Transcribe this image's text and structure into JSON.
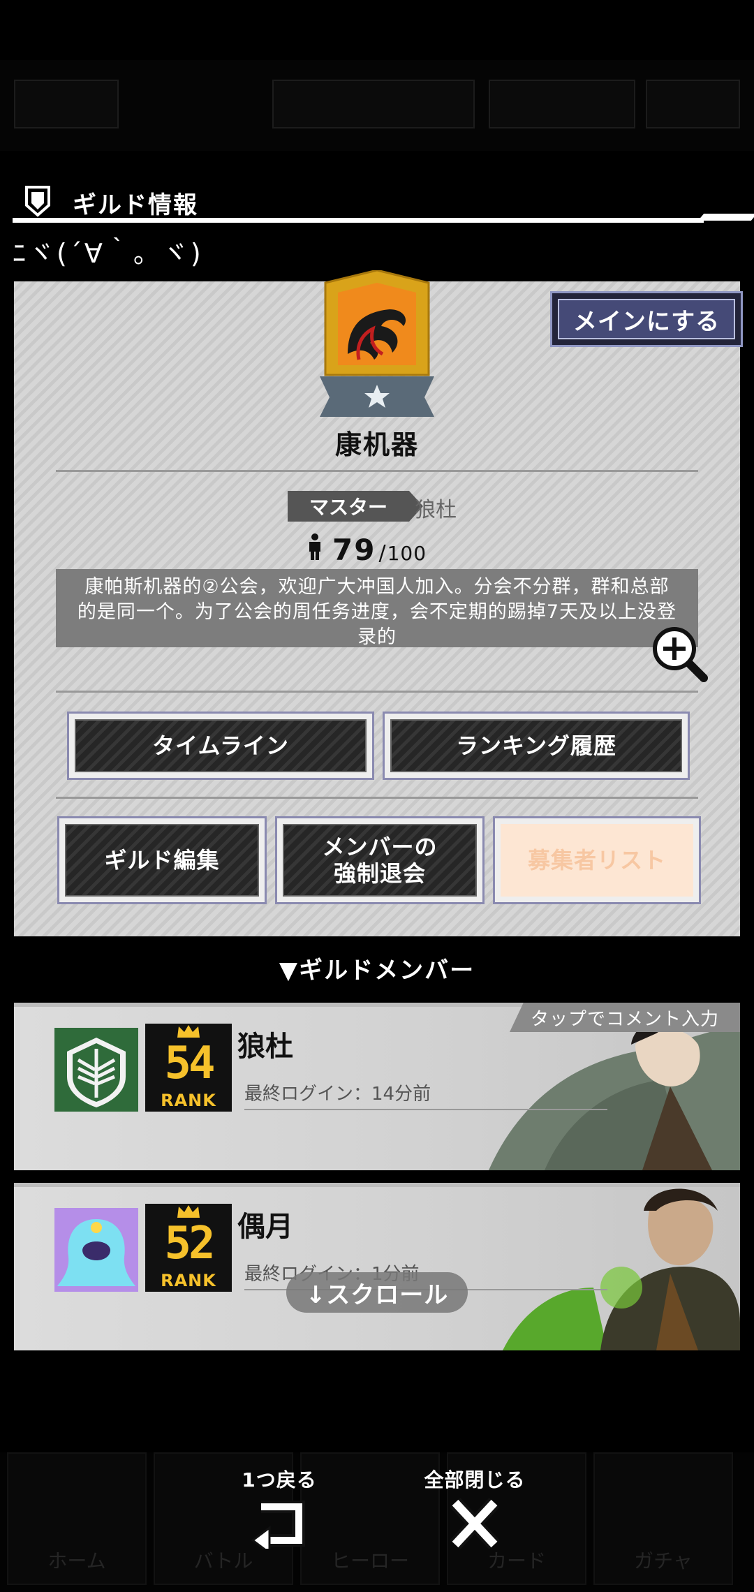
{
  "header": {
    "title": "ギルド情報"
  },
  "guild_sub": "ﾆヾ(´∀｀。ヾ)",
  "guild": {
    "main_button": "メインにする",
    "name": "康机器",
    "master_label": "マスター",
    "master_name": "狼杜",
    "member_current": "79",
    "member_sep": "/",
    "member_max": "100",
    "description": "康帕斯机器的②公会，欢迎广大冲国人加入。分会不分群，群和总部的是同一个。为了公会的周任务进度，会不定期的踢掉7天及以上没登录的"
  },
  "buttons": {
    "timeline": "タイムライン",
    "ranking": "ランキング履歴",
    "edit": "ギルド編集",
    "kick": "メンバーの\n強制退会",
    "applicants": "募集者リスト"
  },
  "section_title": "▼ギルドメンバー",
  "comment_tag": "タップでコメント入力",
  "members": [
    {
      "name": "狼杜",
      "rank_num": "54",
      "rank_label": "RANK",
      "login": "最終ログイン：14分前"
    },
    {
      "name": "偶月",
      "rank_num": "52",
      "rank_label": "RANK",
      "login": "最終ログイン：1分前"
    }
  ],
  "scroll_pill": "↓スクロール",
  "controls": {
    "back": "1つ戻る",
    "close_all": "全部閉じる"
  },
  "colors": {
    "accent_orange": "#f08a1c",
    "emblem_gold": "#d9a31a",
    "rank_gold": "#f6c12b",
    "button_blue": "#454a77"
  },
  "icons": [
    "shield-icon",
    "guild-emblem",
    "person-icon",
    "zoom-in-icon",
    "wings-of-freedom-icon",
    "crown-icon",
    "back-arrow-icon",
    "close-icon"
  ]
}
